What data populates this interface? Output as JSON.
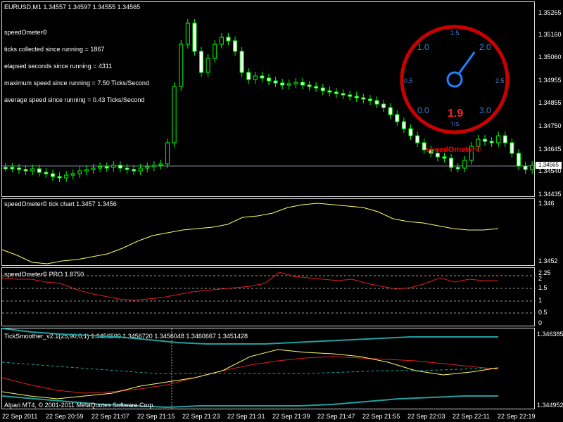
{
  "main": {
    "title": "EURUSD,M1  1.34557 1.34597 1.34555 1.34565",
    "indicator_lines": [
      "speedOmeter©",
      "ticks collected since running = 1867",
      "elapsed seconds since running = 4311",
      "maximum speed since running = 7.50 Ticks/Second",
      "average speed since running = 0.43 Ticks/Second"
    ],
    "price_ticks": [
      "1.35265",
      "1.35160",
      "1.35060",
      "1.34955",
      "1.34855",
      "1.34750",
      "1.34645",
      "1.34540",
      "1.34435"
    ],
    "current_price_tag": "1.34565",
    "watermark": "speedOmeter©"
  },
  "gauge": {
    "value": "1.9",
    "unit": "T/S",
    "scale_labels": [
      "0.0",
      "0.5",
      "1.0",
      "1.5",
      "2.0",
      "2.5",
      "3.0"
    ],
    "needle_value": 1.9,
    "ring_color": "#cc0000",
    "text_color": "#3a7fd0"
  },
  "tick_chart": {
    "title": "speedOmeter© tick chart 1.3457 1.3456",
    "axis": [
      "1.346",
      "1.3452"
    ]
  },
  "pro": {
    "title": "speedOmeter© PRO 1.8750",
    "axis": [
      "2.25",
      "2",
      "1.5",
      "1",
      "0.5",
      "0"
    ]
  },
  "smoother": {
    "title": "TickSmoother_v2.1(25,90,0,1) 1.3456500 1.3456720 1.3456048 1.3460667 1.3451428",
    "axis": [
      "1.346385",
      "1.344952"
    ]
  },
  "footer": {
    "copyright": "Alpari MT4, © 2001-2011 MetaQuotes Software Corp.",
    "time_labels": [
      "22 Sep 2011",
      "22 Sep 20:59",
      "22 Sep 21:07",
      "22 Sep 21:15",
      "22 Sep 21:23",
      "22 Sep 21:31",
      "22 Sep 21:39",
      "22 Sep 21:47",
      "22 Sep 21:55",
      "22 Sep 22:03",
      "22 Sep 22:11",
      "22 Sep 22:19"
    ]
  },
  "colors": {
    "bull": "#00ff00",
    "bear_fill": "#ffffff",
    "line_yellow": "#ffff66",
    "line_red": "#e02020",
    "line_teal": "#20a0a0"
  }
}
